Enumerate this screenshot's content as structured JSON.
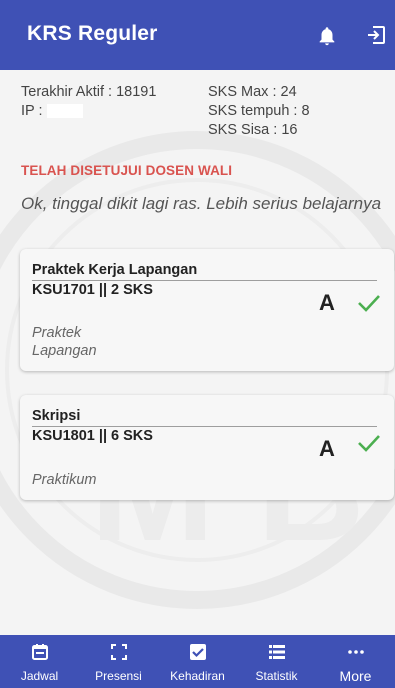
{
  "header": {
    "title": "KRS Reguler"
  },
  "info": {
    "last_active": "Terakhir Aktif : 18191",
    "ip_label": "IP :",
    "sks_max": "SKS Max : 24",
    "sks_tempuh": "SKS tempuh : 8",
    "sks_sisa": "SKS Sisa : 16"
  },
  "status": {
    "approved": "TELAH DISETUJUI DOSEN WALI",
    "note": "Ok, tinggal dikit lagi ras. Lebih serius belajarnya"
  },
  "courses": [
    {
      "name": "Praktek Kerja Lapangan",
      "code": "KSU1701 || 2 SKS",
      "grade": "A",
      "type_line1": "Praktek",
      "type_line2": "Lapangan"
    },
    {
      "name": "Skripsi",
      "code": "KSU1801 || 6 SKS",
      "grade": "A",
      "type_line1": "Praktikum",
      "type_line2": ""
    }
  ],
  "nav": {
    "jadwal": "Jadwal",
    "presensi": "Presensi",
    "kehadiran": "Kehadiran",
    "statistik": "Statistik",
    "more": "More"
  },
  "colors": {
    "primary": "#3f51b5",
    "approved": "#d9534f",
    "check": "#4caf50"
  }
}
